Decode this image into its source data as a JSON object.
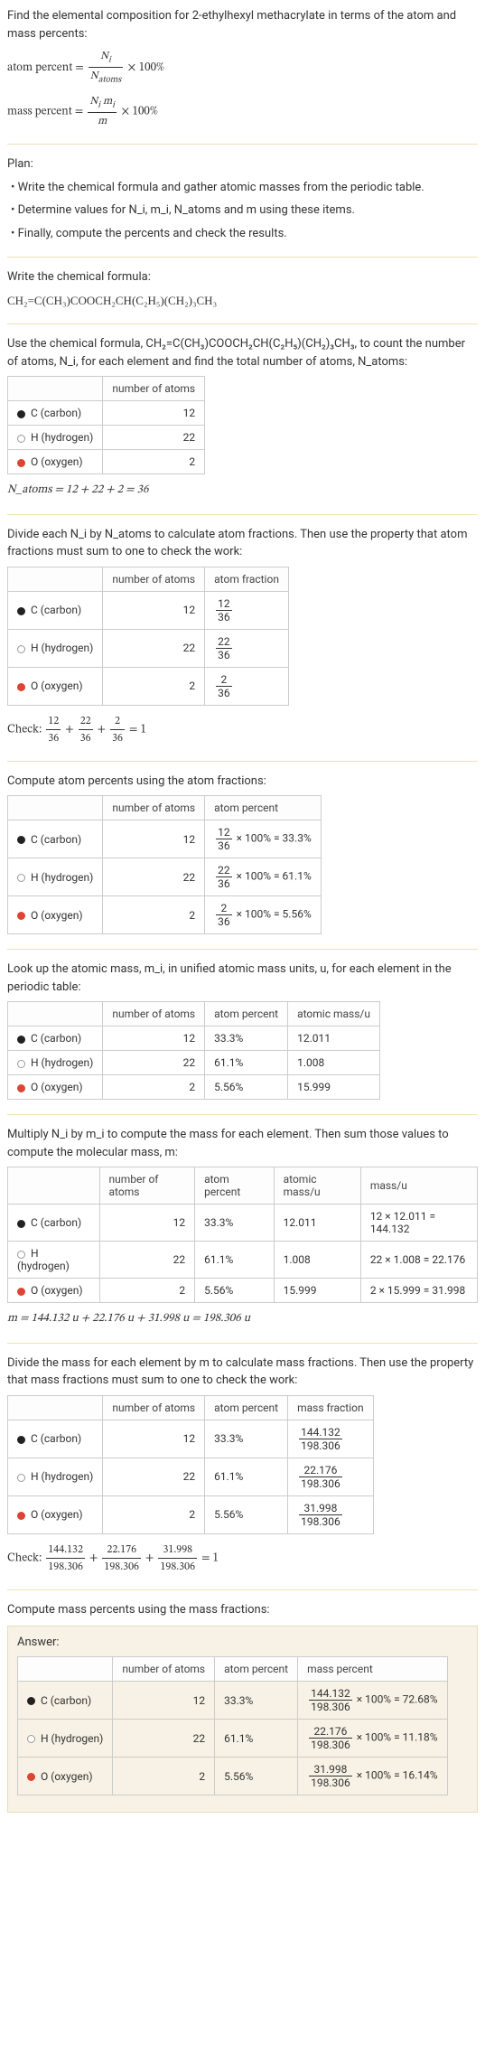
{
  "intro": {
    "title": "Find the elemental composition for 2-ethylhexyl methacrylate in terms of the atom and mass percents:",
    "atom_percent_label": "atom percent = ",
    "atom_frac_num": "N_i",
    "atom_frac_den": "N_atoms",
    "times100": " × 100%",
    "mass_percent_label": "mass percent = ",
    "mass_frac_num": "N_i m_i",
    "mass_frac_den": "m"
  },
  "plan": {
    "label": "Plan:",
    "b1": "• Write the chemical formula and gather atomic masses from the periodic table.",
    "b2": "• Determine values for N_i, m_i, N_atoms and m using these items.",
    "b3": "• Finally, compute the percents and check the results."
  },
  "chemformula": {
    "label": "Write the chemical formula:",
    "formula": "CH₂=C(CH₃)COOCH₂CH(C₂H₅)(CH₂)₃CH₃"
  },
  "countatoms": {
    "intro": "Use the chemical formula, CH₂=C(CH₃)COOCH₂CH(C₂H₅)(CH₂)₃CH₃, to count the number of atoms, N_i, for each element and find the total number of atoms, N_atoms:",
    "hdr_atoms": "number of atoms",
    "rows": [
      {
        "el": "C (carbon)",
        "n": "12"
      },
      {
        "el": "H (hydrogen)",
        "n": "22"
      },
      {
        "el": "O (oxygen)",
        "n": "2"
      }
    ],
    "sum": "N_atoms = 12 + 22 + 2 = 36"
  },
  "atomfrac": {
    "intro": "Divide each N_i by N_atoms to calculate atom fractions. Then use the property that atom fractions must sum to one to check the work:",
    "hdr_atoms": "number of atoms",
    "hdr_frac": "atom fraction",
    "rows": [
      {
        "el": "C (carbon)",
        "n": "12",
        "num": "12",
        "den": "36"
      },
      {
        "el": "H (hydrogen)",
        "n": "22",
        "num": "22",
        "den": "36"
      },
      {
        "el": "O (oxygen)",
        "n": "2",
        "num": "2",
        "den": "36"
      }
    ],
    "check": "Check: ",
    "check_end": " = 1"
  },
  "atompct": {
    "intro": "Compute atom percents using the atom fractions:",
    "hdr_atoms": "number of atoms",
    "hdr_pct": "atom percent",
    "rows": [
      {
        "el": "C (carbon)",
        "n": "12",
        "num": "12",
        "den": "36",
        "pct": " × 100% = 33.3%"
      },
      {
        "el": "H (hydrogen)",
        "n": "22",
        "num": "22",
        "den": "36",
        "pct": " × 100% = 61.1%"
      },
      {
        "el": "O (oxygen)",
        "n": "2",
        "num": "2",
        "den": "36",
        "pct": " × 100% = 5.56%"
      }
    ]
  },
  "masses": {
    "intro": "Look up the atomic mass, m_i, in unified atomic mass units, u, for each element in the periodic table:",
    "hdr_atoms": "number of atoms",
    "hdr_pct": "atom percent",
    "hdr_mass": "atomic mass/u",
    "rows": [
      {
        "el": "C (carbon)",
        "n": "12",
        "pct": "33.3%",
        "m": "12.011"
      },
      {
        "el": "H (hydrogen)",
        "n": "22",
        "pct": "61.1%",
        "m": "1.008"
      },
      {
        "el": "O (oxygen)",
        "n": "2",
        "pct": "5.56%",
        "m": "15.999"
      }
    ]
  },
  "massu": {
    "intro": "Multiply N_i by m_i to compute the mass for each element. Then sum those values to compute the molecular mass, m:",
    "hdr_atoms": "number of atoms",
    "hdr_pct": "atom percent",
    "hdr_mass": "atomic mass/u",
    "hdr_massu": "mass/u",
    "rows": [
      {
        "el": "C (carbon)",
        "n": "12",
        "pct": "33.3%",
        "m": "12.011",
        "calc": "12 × 12.011 = 144.132"
      },
      {
        "el": "H (hydrogen)",
        "n": "22",
        "pct": "61.1%",
        "m": "1.008",
        "calc": "22 × 1.008 = 22.176"
      },
      {
        "el": "O (oxygen)",
        "n": "2",
        "pct": "5.56%",
        "m": "15.999",
        "calc": "2 × 15.999 = 31.998"
      }
    ],
    "sum": "m = 144.132 u + 22.176 u + 31.998 u = 198.306 u"
  },
  "massfrac": {
    "intro": "Divide the mass for each element by m to calculate mass fractions. Then use the property that mass fractions must sum to one to check the work:",
    "hdr_atoms": "number of atoms",
    "hdr_pct": "atom percent",
    "hdr_frac": "mass fraction",
    "rows": [
      {
        "el": "C (carbon)",
        "n": "12",
        "pct": "33.3%",
        "num": "144.132",
        "den": "198.306"
      },
      {
        "el": "H (hydrogen)",
        "n": "22",
        "pct": "61.1%",
        "num": "22.176",
        "den": "198.306"
      },
      {
        "el": "O (oxygen)",
        "n": "2",
        "pct": "5.56%",
        "num": "31.998",
        "den": "198.306"
      }
    ],
    "check": "Check: ",
    "check_end": " = 1"
  },
  "final": {
    "intro": "Compute mass percents using the mass fractions:",
    "answer_label": "Answer:",
    "hdr_atoms": "number of atoms",
    "hdr_pct": "atom percent",
    "hdr_mpct": "mass percent",
    "rows": [
      {
        "el": "C (carbon)",
        "n": "12",
        "pct": "33.3%",
        "num": "144.132",
        "den": "198.306",
        "mpct": " × 100% = 72.68%"
      },
      {
        "el": "H (hydrogen)",
        "n": "22",
        "pct": "61.1%",
        "num": "22.176",
        "den": "198.306",
        "mpct": " × 100% = 11.18%"
      },
      {
        "el": "O (oxygen)",
        "n": "2",
        "pct": "5.56%",
        "num": "31.998",
        "den": "198.306",
        "mpct": " × 100% = 16.14%"
      }
    ]
  }
}
